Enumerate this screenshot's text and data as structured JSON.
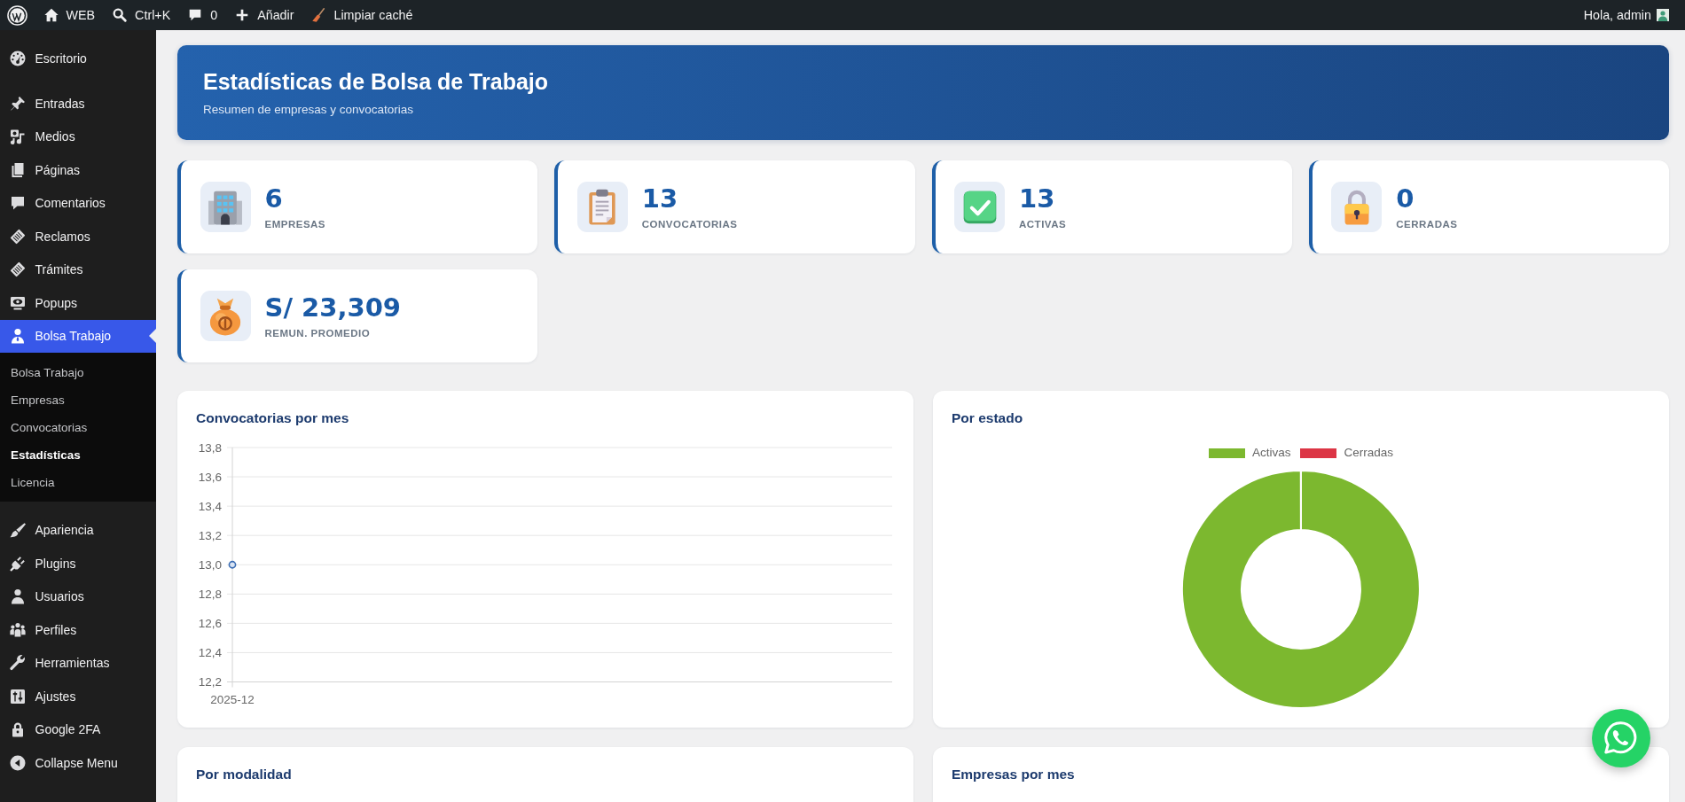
{
  "admin_bar": {
    "items": [
      {
        "label": "WEB"
      },
      {
        "label": "Ctrl+K"
      },
      {
        "label": "0"
      },
      {
        "label": "Añadir"
      },
      {
        "label": "Limpiar caché"
      }
    ],
    "greeting": "Hola, admin"
  },
  "sidebar": {
    "sections": [
      {
        "items": [
          {
            "label": "Escritorio",
            "selected": false
          }
        ]
      },
      {
        "items": [
          {
            "label": "Entradas",
            "selected": false
          },
          {
            "label": "Medios",
            "selected": false
          },
          {
            "label": "Páginas",
            "selected": false
          },
          {
            "label": "Comentarios",
            "selected": false
          },
          {
            "label": "Reclamos",
            "selected": false
          },
          {
            "label": "Trámites",
            "selected": false
          },
          {
            "label": "Popups",
            "selected": false
          },
          {
            "label": "Bolsa Trabajo",
            "selected": true,
            "expanded": true,
            "children": [
              {
                "label": "Bolsa Trabajo",
                "selected": false
              },
              {
                "label": "Empresas",
                "selected": false
              },
              {
                "label": "Convocatorias",
                "selected": false
              },
              {
                "label": "Estadísticas",
                "selected": true
              },
              {
                "label": "Licencia",
                "selected": false
              }
            ]
          }
        ]
      },
      {
        "items": [
          {
            "label": "Apariencia",
            "selected": false
          },
          {
            "label": "Plugins",
            "selected": false
          },
          {
            "label": "Usuarios",
            "selected": false
          },
          {
            "label": "Perfiles",
            "selected": false
          },
          {
            "label": "Herramientas",
            "selected": false
          },
          {
            "label": "Ajustes",
            "selected": false
          },
          {
            "label": "Google 2FA",
            "selected": false
          }
        ]
      }
    ],
    "collapse": {
      "label": "Collapse Menu"
    }
  },
  "header": {
    "title": "Estadísticas de Bolsa de Trabajo",
    "subtitle": "Resumen de empresas y convocatorias"
  },
  "stats": [
    {
      "value": "6",
      "label": "EMPRESAS"
    },
    {
      "value": "13",
      "label": "CONVOCATORIAS"
    },
    {
      "value": "13",
      "label": "ACTIVAS"
    },
    {
      "value": "0",
      "label": "CERRADAS"
    },
    {
      "value": "S/ 23,309",
      "label": "REMUN. PROMEDIO"
    }
  ],
  "panels": [
    {
      "title": "Convocatorias por mes",
      "chart_data": {
        "type": "line",
        "grid": true,
        "categories": [
          "2025-12"
        ],
        "series": [
          {
            "color": "#3b6db3",
            "marker": "circle",
            "values": [
              13
            ]
          }
        ],
        "ylim": [
          12.2,
          13.8
        ],
        "yticks": [
          {
            "value": 12.2,
            "label": "12,2"
          },
          {
            "value": 12.4,
            "label": "12,4"
          },
          {
            "value": 12.6,
            "label": "12,6"
          },
          {
            "value": 12.8,
            "label": "12,8"
          },
          {
            "value": 13.0,
            "label": "13,0"
          },
          {
            "value": 13.2,
            "label": "13,2"
          },
          {
            "value": 13.4,
            "label": "13,4"
          },
          {
            "value": 13.6,
            "label": "13,6"
          },
          {
            "value": 13.8,
            "label": "13,8"
          }
        ]
      }
    },
    {
      "title": "Por estado",
      "chart_data": {
        "type": "donut",
        "categories": [
          "Activas",
          "Cerradas"
        ],
        "values": [
          100,
          0
        ],
        "colors": [
          "#7cb82f",
          "#dc3545"
        ]
      }
    },
    {
      "title": "Por modalidad"
    },
    {
      "title": "Empresas por mes"
    }
  ]
}
